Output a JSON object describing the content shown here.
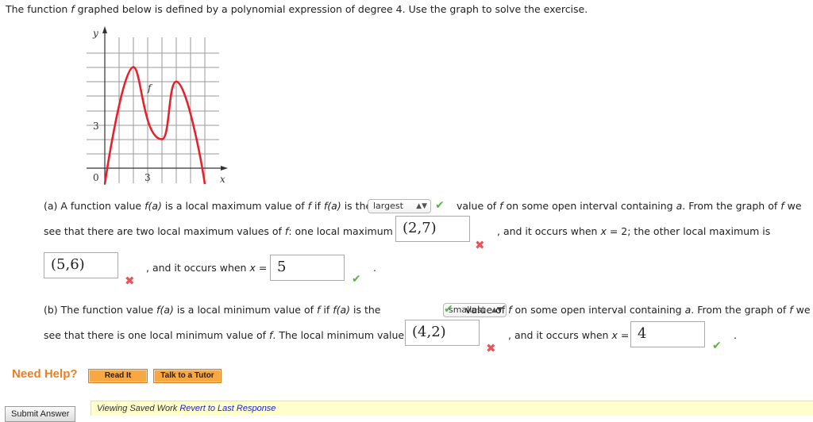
{
  "intro": {
    "before_f": "The function ",
    "f": "f",
    "after_f": " graphed below is defined by a polynomial expression of degree 4. Use the graph to solve the exercise."
  },
  "graph": {
    "y_axis_label": "y",
    "x_axis_label": "x",
    "y_tick_label": "3",
    "x_tick_label": "3",
    "origin_label": "0",
    "curve_label": "f",
    "curve_color": "#e8202c",
    "local_maxima": [
      [
        2,
        7
      ],
      [
        5,
        6
      ]
    ],
    "local_minima": [
      [
        4,
        2
      ]
    ]
  },
  "part_a": {
    "line1_start": "(a) A function value ",
    "line1_fa": "f(a)",
    "line1_mid": " is a local maximum value of ",
    "line1_f": "f",
    "line1_if": " if ",
    "line1_fa2": "f(a)",
    "line1_is_the": " is the",
    "select_value": "largest",
    "line1_end_a": "value of ",
    "line1_end_f": "f",
    "line1_end_b": " on some open interval containing ",
    "line1_end_a_var": "a",
    "line1_end_c": ". From the graph of ",
    "line1_end_f2": "f",
    "line1_end_d": " we",
    "line2_start": "see that there are two local maximum values of ",
    "line2_f": "f",
    "line2_end": ": one local maximum is",
    "answer1": "(2,7)",
    "after_answer1": ", and it occurs when ",
    "x_var": "x",
    "after_answer1_b": " = 2;  the other local maximum is",
    "answer2": "(5,6)",
    "after_answer2": ", and it occurs when ",
    "equals": " =",
    "answer3": "5",
    "period": "."
  },
  "part_b": {
    "line1_start": "(b) The function value ",
    "line1_fa": "f(a)",
    "line1_mid": " is a local minimum value of ",
    "line1_f": "f",
    "line1_if": " if ",
    "line1_fa2": "f(a)",
    "line1_is_the": " is the",
    "select_value": "smallest",
    "line1_end_a": "value of ",
    "line1_end_f": "f",
    "line1_end_b": " on some open interval containing ",
    "line1_end_a_var": "a",
    "line1_end_c": ". From the graph of ",
    "line1_end_f2": "f",
    "line1_end_d": " we",
    "line2_start": "see that there is one local minimum value of ",
    "line2_f": "f",
    "line2_end": ". The local minimum value is",
    "answer1": "(4,2)",
    "after_answer1": ", and it occurs when ",
    "x_var": "x",
    "equals": " =",
    "answer2": "4",
    "period": "."
  },
  "help": {
    "label": "Need Help?",
    "read_it": "Read It",
    "talk_to_tutor": "Talk to a Tutor"
  },
  "footer": {
    "submit": "Submit Answer",
    "viewing_saved": "Viewing Saved Work ",
    "revert_link": "Revert to Last Response"
  },
  "marks": {
    "check": "✔",
    "cross": "✖"
  }
}
